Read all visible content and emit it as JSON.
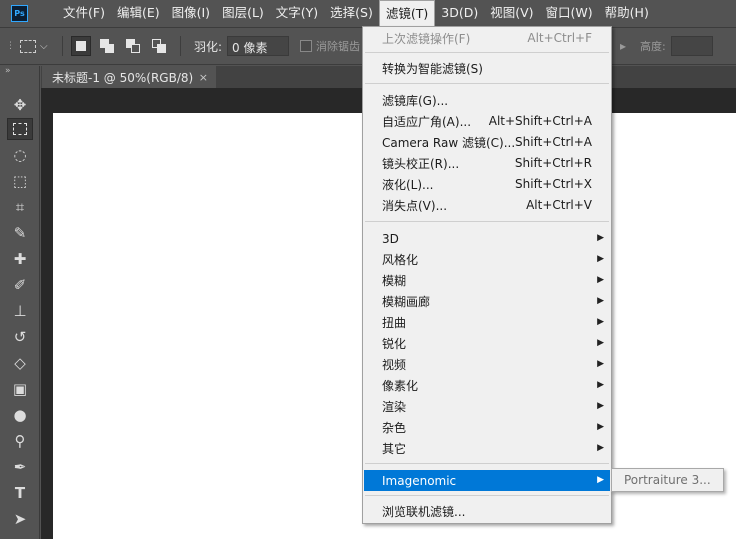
{
  "app": {
    "logo": "Ps"
  },
  "menubar": {
    "items": [
      "文件(F)",
      "编辑(E)",
      "图像(I)",
      "图层(L)",
      "文字(Y)",
      "选择(S)",
      "滤镜(T)",
      "3D(D)",
      "视图(V)",
      "窗口(W)",
      "帮助(H)"
    ],
    "active_index": 6
  },
  "options": {
    "feather_label": "羽化:",
    "feather_value": "0 像素",
    "antialias_label": "消除锯齿",
    "height_label": "高度:"
  },
  "document_tab": {
    "title": "未标题-1 @ 50%(RGB/8)",
    "close": "×"
  },
  "filter_menu": {
    "last_filter": {
      "label": "上次滤镜操作(F)",
      "shortcut": "Alt+Ctrl+F"
    },
    "convert_smart": {
      "label": "转换为智能滤镜(S)"
    },
    "gallery_group": [
      {
        "label": "滤镜库(G)...",
        "shortcut": ""
      },
      {
        "label": "自适应广角(A)...",
        "shortcut": "Alt+Shift+Ctrl+A"
      },
      {
        "label": "Camera Raw 滤镜(C)...",
        "shortcut": "Shift+Ctrl+A"
      },
      {
        "label": "镜头校正(R)...",
        "shortcut": "Shift+Ctrl+R"
      },
      {
        "label": "液化(L)...",
        "shortcut": "Shift+Ctrl+X"
      },
      {
        "label": "消失点(V)...",
        "shortcut": "Alt+Ctrl+V"
      }
    ],
    "submenus": [
      "3D",
      "风格化",
      "模糊",
      "模糊画廊",
      "扭曲",
      "锐化",
      "视频",
      "像素化",
      "渲染",
      "杂色",
      "其它"
    ],
    "plugin": {
      "label": "Imagenomic"
    },
    "browse": {
      "label": "浏览联机滤镜..."
    }
  },
  "plugin_submenu": {
    "item": "Portraiture 3..."
  },
  "colors": {
    "highlight": "#0078d7",
    "menu_bg": "#f0f0f0",
    "ui_bg": "#535353"
  }
}
